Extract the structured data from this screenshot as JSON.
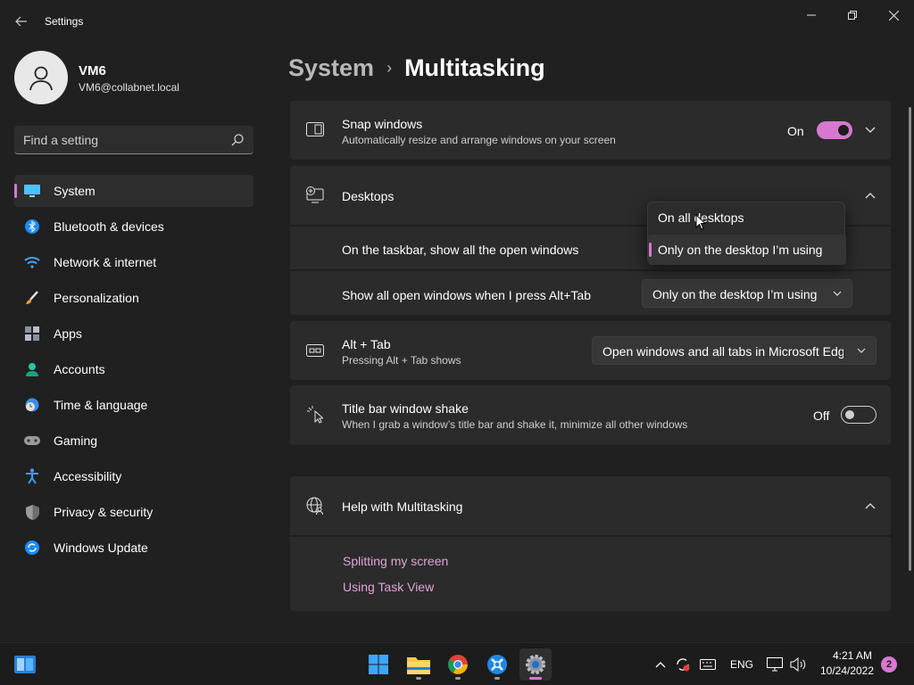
{
  "window": {
    "title": "Settings"
  },
  "user": {
    "name": "VM6",
    "email": "VM6@collabnet.local"
  },
  "search": {
    "placeholder": "Find a setting"
  },
  "sidebar": {
    "items": [
      {
        "label": "System",
        "icon": "monitor-icon",
        "active": true
      },
      {
        "label": "Bluetooth & devices",
        "icon": "bluetooth-icon"
      },
      {
        "label": "Network & internet",
        "icon": "wifi-icon"
      },
      {
        "label": "Personalization",
        "icon": "brush-icon"
      },
      {
        "label": "Apps",
        "icon": "apps-icon"
      },
      {
        "label": "Accounts",
        "icon": "person-icon"
      },
      {
        "label": "Time & language",
        "icon": "clock-globe-icon"
      },
      {
        "label": "Gaming",
        "icon": "gamepad-icon"
      },
      {
        "label": "Accessibility",
        "icon": "accessibility-icon"
      },
      {
        "label": "Privacy & security",
        "icon": "shield-icon"
      },
      {
        "label": "Windows Update",
        "icon": "update-icon"
      }
    ]
  },
  "breadcrumb": {
    "parent": "System",
    "separator": "›",
    "current": "Multitasking"
  },
  "snap": {
    "title": "Snap windows",
    "desc": "Automatically resize and arrange windows on your screen",
    "state": "On"
  },
  "desktops": {
    "title": "Desktops",
    "taskbar_label": "On the taskbar, show all the open windows",
    "alttab_label": "Show all open windows when I press Alt+Tab",
    "alttab_value": "Only on the desktop I’m using",
    "dropdown_options": [
      "On all desktops",
      "Only on the desktop I’m using"
    ]
  },
  "alt_tab": {
    "title": "Alt + Tab",
    "desc": "Pressing Alt + Tab shows",
    "value": "Open windows and all tabs in Microsoft Edge"
  },
  "shake": {
    "title": "Title bar window shake",
    "desc": "When I grab a window’s title bar and shake it, minimize all other windows",
    "state": "Off"
  },
  "help": {
    "title": "Help with Multitasking",
    "links": [
      "Splitting my screen",
      "Using Task View"
    ]
  },
  "taskbar": {
    "apps": [
      "widgets-icon",
      "start-icon",
      "file-explorer-icon",
      "chrome-icon",
      "app-icon",
      "settings-icon"
    ],
    "language": "ENG",
    "time": "4:21 AM",
    "date": "10/24/2022",
    "notifications": "2"
  },
  "colors": {
    "accent": "#d877d0",
    "background": "#202020",
    "card": "#2b2b2b"
  }
}
